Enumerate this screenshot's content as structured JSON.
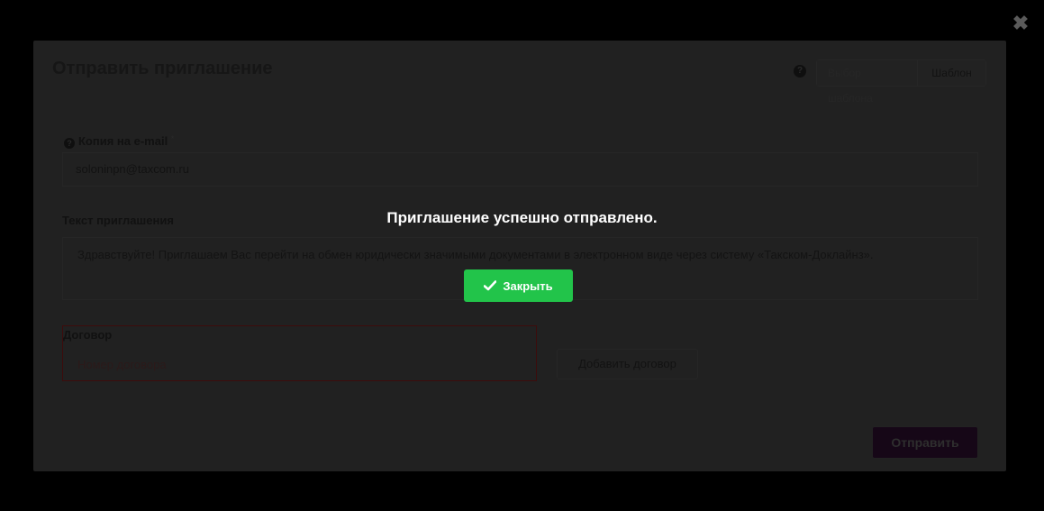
{
  "window": {
    "close_icon": "close-x-icon"
  },
  "modal": {
    "title": "Отправить приглашение",
    "header_buttons": {
      "first_label": "Выбор шаблона",
      "second_label": "Шаблон"
    },
    "email": {
      "label": "Копия на e-mail",
      "required_mark": "*",
      "value": "soloninpn@taxcom.ru"
    },
    "message": {
      "label": "Текст приглашения",
      "value": "Здравствуйте! Приглашаем Вас перейти на обмен юридически значимыми документами в электронном виде через систему «Такском-Доклайнз»."
    },
    "contract": {
      "label": "Договор",
      "placeholder": "Номер договора",
      "add_button": "Добавить договор"
    },
    "send_button": "Отправить"
  },
  "dialog": {
    "message": "Приглашение успешно отправлено.",
    "close_button": "Закрыть"
  },
  "colors": {
    "success": "#22c44a",
    "error_border": "#3d0c0c"
  }
}
